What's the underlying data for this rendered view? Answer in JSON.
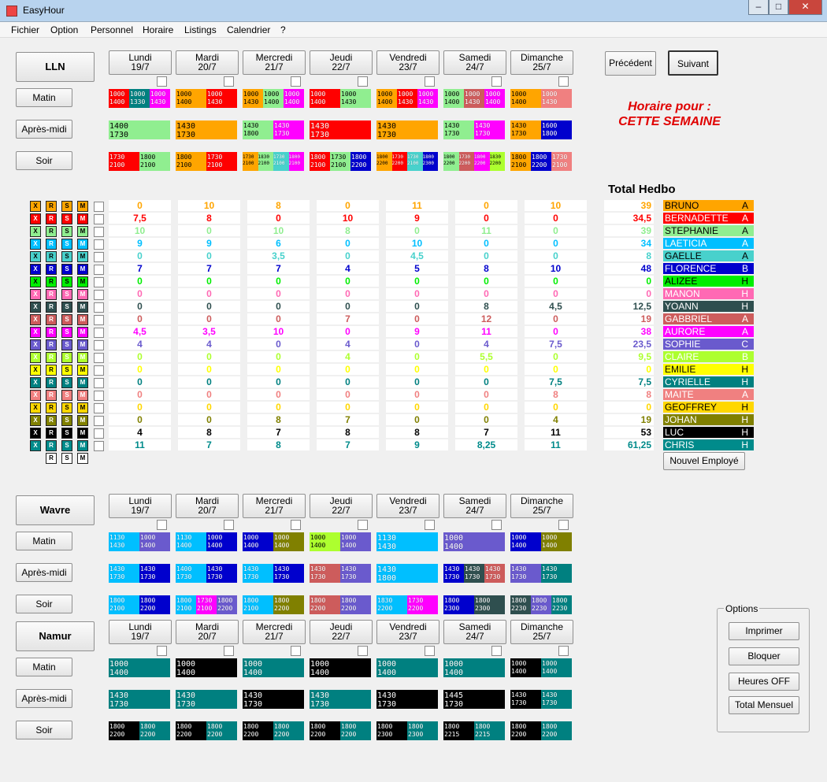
{
  "window": {
    "title": "EasyHour"
  },
  "menu": [
    "Fichier",
    "Option",
    "Personnel",
    "Horaire",
    "Listings",
    "Calendrier",
    "?"
  ],
  "nav": {
    "prev": "Précédent",
    "next": "Suivant"
  },
  "heading": "Horaire pour :\nCETTE SEMAINE",
  "total_header": "Total Hedbo",
  "new_employee": "Nouvel Employé",
  "days": [
    {
      "name": "Lundi",
      "date": "19/7"
    },
    {
      "name": "Mardi",
      "date": "20/7"
    },
    {
      "name": "Mercredi",
      "date": "21/7"
    },
    {
      "name": "Jeudi",
      "date": "22/7"
    },
    {
      "name": "Vendredi",
      "date": "23/7"
    },
    {
      "name": "Samedi",
      "date": "24/7"
    },
    {
      "name": "Dimanche",
      "date": "25/7"
    }
  ],
  "shifts": [
    "Matin",
    "Après-midi",
    "Soir"
  ],
  "colors": {
    "bruno": "#ffa500",
    "bernadette": "#ff0000",
    "stephanie": "#90ee90",
    "laeticia": "#00bfff",
    "gaelle": "#48d1cc",
    "florence": "#0000cd",
    "alizee": "#00ee00",
    "manon": "#ff69b4",
    "yoann": "#2f4f4f",
    "gabbriel": "#cd5c5c",
    "aurore": "#ff00ff",
    "sophie": "#6a5acd",
    "claire": "#adff2f",
    "emilie": "#ffff00",
    "cyrielle": "#008080",
    "maite": "#f08080",
    "geoffrey": "#ffd700",
    "johan": "#808000",
    "luc": "#000000",
    "chris": "#008b8b"
  },
  "sites": [
    {
      "name": "LLN",
      "rows": [
        [
          [
            [
              "1000\n1400",
              "#ff0000"
            ],
            [
              "1000\n1330",
              "#008080"
            ],
            [
              "1000\n1430",
              "#ff00ff"
            ]
          ],
          [
            [
              "1000\n1400",
              "#ffa500"
            ],
            [
              "1000\n1430",
              "#ff0000"
            ]
          ],
          [
            [
              "1000\n1430",
              "#ffa500"
            ],
            [
              "1000\n1400",
              "#90ee90"
            ],
            [
              "1000\n1400",
              "#ff00ff"
            ]
          ],
          [
            [
              "1000\n1400",
              "#ff0000"
            ],
            [
              "1000\n1430",
              "#90ee90"
            ]
          ],
          [
            [
              "1000\n1400",
              "#ffa500"
            ],
            [
              "1000\n1430",
              "#ff0000"
            ],
            [
              "1000\n1430",
              "#ff00ff"
            ]
          ],
          [
            [
              "1000\n1400",
              "#90ee90"
            ],
            [
              "1000\n1430",
              "#cd5c5c"
            ],
            [
              "1000\n1400",
              "#ff00ff"
            ]
          ],
          [
            [
              "1000\n1400",
              "#ffa500"
            ],
            [
              "1000\n1430",
              "#f08080"
            ]
          ]
        ],
        [
          [
            [
              "1400\n1730",
              "#90ee90"
            ]
          ],
          [
            [
              "1430\n1730",
              "#ffa500"
            ]
          ],
          [
            [
              "1430\n1800",
              "#90ee90"
            ],
            [
              "1430\n1730",
              "#ff00ff"
            ]
          ],
          [
            [
              "1430\n1730",
              "#ff0000"
            ]
          ],
          [
            [
              "1430\n1730",
              "#ffa500"
            ]
          ],
          [
            [
              "1430\n1730",
              "#90ee90"
            ],
            [
              "1430\n1730",
              "#ff00ff"
            ]
          ],
          [
            [
              "1430\n1730",
              "#ffa500"
            ],
            [
              "1600\n1800",
              "#0000cd"
            ]
          ]
        ],
        [
          [
            [
              "1730\n2100",
              "#ff0000"
            ],
            [
              "1800\n2100",
              "#90ee90"
            ]
          ],
          [
            [
              "1800\n2100",
              "#ffa500"
            ],
            [
              "1730\n2100",
              "#ff0000"
            ]
          ],
          [
            [
              "1730\n2100",
              "#ffa500"
            ],
            [
              "1830\n2100",
              "#90ee90"
            ],
            [
              "1730\n2100",
              "#48d1cc"
            ],
            [
              "1800\n2100",
              "#ff00ff"
            ]
          ],
          [
            [
              "1800\n2100",
              "#ff0000"
            ],
            [
              "1730\n2100",
              "#90ee90"
            ],
            [
              "1800\n2200",
              "#0000cd"
            ]
          ],
          [
            [
              "1800\n2200",
              "#ffa500"
            ],
            [
              "1730\n2200",
              "#ff0000"
            ],
            [
              "1730\n2100",
              "#48d1cc"
            ],
            [
              "1800\n2300",
              "#0000cd"
            ]
          ],
          [
            [
              "1800\n2200",
              "#90ee90"
            ],
            [
              "1730\n2200",
              "#cd5c5c"
            ],
            [
              "1800\n2200",
              "#ff00ff"
            ],
            [
              "1830\n2200",
              "#adff2f"
            ]
          ],
          [
            [
              "1800\n2100",
              "#ffa500"
            ],
            [
              "1800\n2200",
              "#0000cd"
            ],
            [
              "1730\n2100",
              "#f08080"
            ]
          ]
        ]
      ]
    },
    {
      "name": "Wavre",
      "rows": [
        [
          [
            [
              "1130\n1430",
              "#00bfff"
            ],
            [
              "1000\n1400",
              "#6a5acd"
            ]
          ],
          [
            [
              "1130\n1400",
              "#00bfff"
            ],
            [
              "1000\n1400",
              "#0000cd"
            ]
          ],
          [
            [
              "1000\n1400",
              "#0000cd"
            ],
            [
              "1000\n1400",
              "#808000"
            ]
          ],
          [
            [
              "1000\n1400",
              "#adff2f"
            ],
            [
              "1000\n1400",
              "#6a5acd"
            ]
          ],
          [
            [
              "1130\n1430",
              "#00bfff"
            ]
          ],
          [
            [
              "1000\n1400",
              "#6a5acd"
            ]
          ],
          [
            [
              "1000\n1400",
              "#0000cd"
            ],
            [
              "1000\n1400",
              "#808000"
            ]
          ]
        ],
        [
          [
            [
              "1430\n1730",
              "#00bfff"
            ],
            [
              "1430\n1730",
              "#0000cd"
            ]
          ],
          [
            [
              "1400\n1730",
              "#00bfff"
            ],
            [
              "1430\n1730",
              "#0000cd"
            ]
          ],
          [
            [
              "1430\n1730",
              "#00bfff"
            ],
            [
              "1430\n1730",
              "#0000cd"
            ]
          ],
          [
            [
              "1430\n1730",
              "#cd5c5c"
            ],
            [
              "1430\n1730",
              "#6a5acd"
            ]
          ],
          [
            [
              "1430\n1800",
              "#00bfff"
            ]
          ],
          [
            [
              "1430\n1730",
              "#0000cd"
            ],
            [
              "1430\n1730",
              "#2f4f4f"
            ],
            [
              "1430\n1730",
              "#cd5c5c"
            ]
          ],
          [
            [
              "1430\n1730",
              "#6a5acd"
            ],
            [
              "1430\n1730",
              "#008080"
            ]
          ]
        ],
        [
          [
            [
              "1800\n2100",
              "#00bfff"
            ],
            [
              "1800\n2200",
              "#0000cd"
            ]
          ],
          [
            [
              "1800\n2100",
              "#00bfff"
            ],
            [
              "1730\n2100",
              "#ff00ff"
            ],
            [
              "1800\n2200",
              "#6a5acd"
            ]
          ],
          [
            [
              "1800\n2100",
              "#00bfff"
            ],
            [
              "1800\n2200",
              "#808000"
            ]
          ],
          [
            [
              "1800\n2200",
              "#cd5c5c"
            ],
            [
              "1800\n2200",
              "#6a5acd"
            ]
          ],
          [
            [
              "1830\n2200",
              "#00bfff"
            ],
            [
              "1730\n2200",
              "#ff00ff"
            ]
          ],
          [
            [
              "1800\n2300",
              "#0000cd"
            ],
            [
              "1800\n2300",
              "#2f4f4f"
            ]
          ],
          [
            [
              "1800\n2230",
              "#2f4f4f"
            ],
            [
              "1800\n2230",
              "#6a5acd"
            ],
            [
              "1800\n2230",
              "#008080"
            ]
          ]
        ]
      ]
    },
    {
      "name": "Namur",
      "rows": [
        [
          [
            [
              "1000\n1400",
              "#008080"
            ]
          ],
          [
            [
              "1000\n1400",
              "#000000"
            ]
          ],
          [
            [
              "1000\n1400",
              "#008080"
            ]
          ],
          [
            [
              "1000\n1400",
              "#000000"
            ]
          ],
          [
            [
              "1000\n1400",
              "#008080"
            ]
          ],
          [
            [
              "1000\n1400",
              "#008080"
            ]
          ],
          [
            [
              "1000\n1400",
              "#000000"
            ],
            [
              "1000\n1400",
              "#008080"
            ]
          ]
        ],
        [
          [
            [
              "1430\n1730",
              "#008080"
            ]
          ],
          [
            [
              "1430\n1730",
              "#008080"
            ]
          ],
          [
            [
              "1430\n1730",
              "#000000"
            ]
          ],
          [
            [
              "1430\n1730",
              "#008080"
            ]
          ],
          [
            [
              "1430\n1730",
              "#000000"
            ]
          ],
          [
            [
              "1445\n1730",
              "#000000"
            ]
          ],
          [
            [
              "1430\n1730",
              "#000000"
            ],
            [
              "1430\n1730",
              "#008080"
            ]
          ]
        ],
        [
          [
            [
              "1800\n2200",
              "#000000"
            ],
            [
              "1800\n2200",
              "#008080"
            ]
          ],
          [
            [
              "1800\n2200",
              "#000000"
            ],
            [
              "1800\n2200",
              "#008080"
            ]
          ],
          [
            [
              "1800\n2200",
              "#000000"
            ],
            [
              "1800\n2200",
              "#008080"
            ]
          ],
          [
            [
              "1800\n2200",
              "#000000"
            ],
            [
              "1800\n2200",
              "#008080"
            ]
          ],
          [
            [
              "1800\n2300",
              "#000000"
            ],
            [
              "1800\n2300",
              "#008080"
            ]
          ],
          [
            [
              "1800\n2215",
              "#000000"
            ],
            [
              "1800\n2215",
              "#008080"
            ]
          ],
          [
            [
              "1800\n2200",
              "#000000"
            ],
            [
              "1800\n2200",
              "#008080"
            ]
          ]
        ]
      ]
    }
  ],
  "employees": [
    {
      "name": "BRUNO",
      "cat": "A",
      "color": "#ffa500",
      "text": "#000",
      "hours": [
        "0",
        "10",
        "8",
        "0",
        "11",
        "0",
        "10"
      ],
      "total": "39"
    },
    {
      "name": "BERNADETTE",
      "cat": "A",
      "color": "#ff0000",
      "text": "#fff",
      "hours": [
        "7,5",
        "8",
        "0",
        "10",
        "9",
        "0",
        "0"
      ],
      "total": "34,5"
    },
    {
      "name": "STEPHANIE",
      "cat": "A",
      "color": "#90ee90",
      "text": "#000",
      "hours": [
        "10",
        "0",
        "10",
        "8",
        "0",
        "11",
        "0"
      ],
      "total": "39"
    },
    {
      "name": "LAETICIA",
      "cat": "A",
      "color": "#00bfff",
      "text": "#fff",
      "hours": [
        "9",
        "9",
        "6",
        "0",
        "10",
        "0",
        "0"
      ],
      "total": "34"
    },
    {
      "name": "GAELLE",
      "cat": "A",
      "color": "#48d1cc",
      "text": "#000",
      "hours": [
        "0",
        "0",
        "3,5",
        "0",
        "4,5",
        "0",
        "0"
      ],
      "total": "8"
    },
    {
      "name": "FLORENCE",
      "cat": "B",
      "color": "#0000cd",
      "text": "#fff",
      "hours": [
        "7",
        "7",
        "7",
        "4",
        "5",
        "8",
        "10"
      ],
      "total": "48"
    },
    {
      "name": "ALIZEE",
      "cat": "H",
      "color": "#00ee00",
      "text": "#000",
      "hours": [
        "0",
        "0",
        "0",
        "0",
        "0",
        "0",
        "0"
      ],
      "total": "0"
    },
    {
      "name": "MANON",
      "cat": "H",
      "color": "#ff69b4",
      "text": "#fff",
      "hours": [
        "0",
        "0",
        "0",
        "0",
        "0",
        "0",
        "0"
      ],
      "total": "0"
    },
    {
      "name": "YOANN",
      "cat": "H",
      "color": "#2f4f4f",
      "text": "#fff",
      "hours": [
        "0",
        "0",
        "0",
        "0",
        "0",
        "8",
        "4,5"
      ],
      "total": "12,5"
    },
    {
      "name": "GABBRIEL",
      "cat": "A",
      "color": "#cd5c5c",
      "text": "#fff",
      "hours": [
        "0",
        "0",
        "0",
        "7",
        "0",
        "12",
        "0"
      ],
      "total": "19"
    },
    {
      "name": "AURORE",
      "cat": "A",
      "color": "#ff00ff",
      "text": "#fff",
      "hours": [
        "4,5",
        "3,5",
        "10",
        "0",
        "9",
        "11",
        "0"
      ],
      "total": "38"
    },
    {
      "name": "SOPHIE",
      "cat": "C",
      "color": "#6a5acd",
      "text": "#fff",
      "hours": [
        "4",
        "4",
        "0",
        "4",
        "0",
        "4",
        "7,5"
      ],
      "total": "23,5"
    },
    {
      "name": "CLAIRE",
      "cat": "B",
      "color": "#adff2f",
      "text": "#fff",
      "hours": [
        "0",
        "0",
        "0",
        "4",
        "0",
        "5,5",
        "0"
      ],
      "total": "9,5"
    },
    {
      "name": "EMILIE",
      "cat": "H",
      "color": "#ffff00",
      "text": "#000",
      "hours": [
        "0",
        "0",
        "0",
        "0",
        "0",
        "0",
        "0"
      ],
      "total": "0"
    },
    {
      "name": "CYRIELLE",
      "cat": "H",
      "color": "#008080",
      "text": "#fff",
      "hours": [
        "0",
        "0",
        "0",
        "0",
        "0",
        "0",
        "7,5"
      ],
      "total": "7,5"
    },
    {
      "name": "MAITE",
      "cat": "A",
      "color": "#f08080",
      "text": "#fff",
      "hours": [
        "0",
        "0",
        "0",
        "0",
        "0",
        "0",
        "8"
      ],
      "total": "8"
    },
    {
      "name": "GEOFFREY",
      "cat": "H",
      "color": "#ffd700",
      "text": "#000",
      "hours": [
        "0",
        "0",
        "0",
        "0",
        "0",
        "0",
        "0"
      ],
      "total": "0"
    },
    {
      "name": "JOHAN",
      "cat": "H",
      "color": "#808000",
      "text": "#fff",
      "hours": [
        "0",
        "0",
        "8",
        "7",
        "0",
        "0",
        "4"
      ],
      "total": "19"
    },
    {
      "name": "LUC",
      "cat": "H",
      "color": "#000000",
      "text": "#fff",
      "hours": [
        "4",
        "8",
        "7",
        "8",
        "8",
        "7",
        "11"
      ],
      "total": "53"
    },
    {
      "name": "CHRIS",
      "cat": "H",
      "color": "#008b8b",
      "text": "#fff",
      "hours": [
        "11",
        "7",
        "8",
        "7",
        "9",
        "8,25",
        "11"
      ],
      "total": "61,25"
    }
  ],
  "empty_row": {
    "letters": [
      "R",
      "S",
      "M"
    ]
  },
  "options": {
    "legend": "Options",
    "buttons": [
      "Imprimer",
      "Bloquer",
      "Heures OFF",
      "Total Mensuel"
    ]
  }
}
